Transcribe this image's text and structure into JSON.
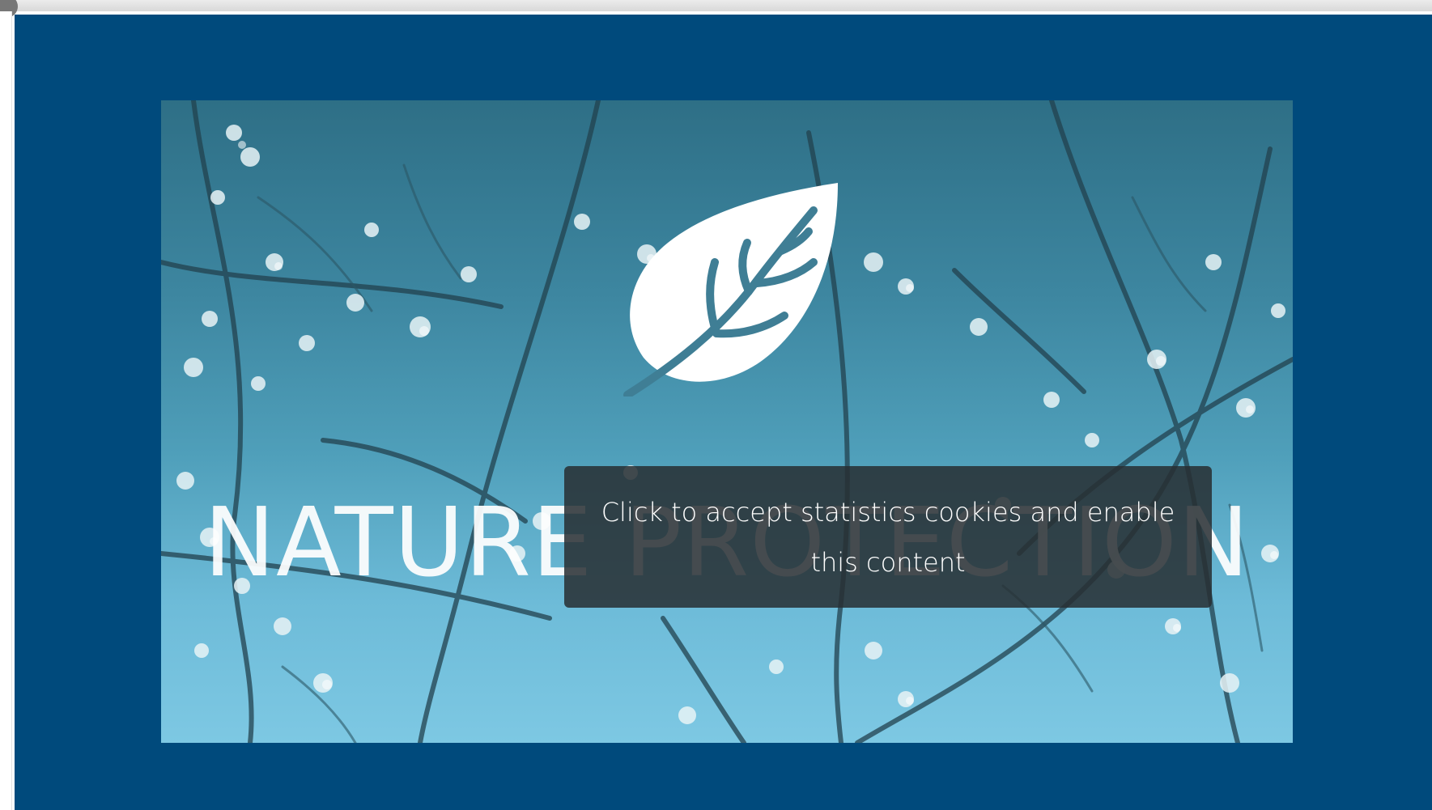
{
  "video": {
    "title": "NATURE PROTECTION"
  },
  "cookie_notice": {
    "text": "Click to accept statistics cookies and enable this content"
  },
  "colors": {
    "frame": "#004a7c",
    "overlay": "#282e32",
    "title": "#ffffff"
  },
  "icons": {
    "logo": "leaf-icon"
  }
}
